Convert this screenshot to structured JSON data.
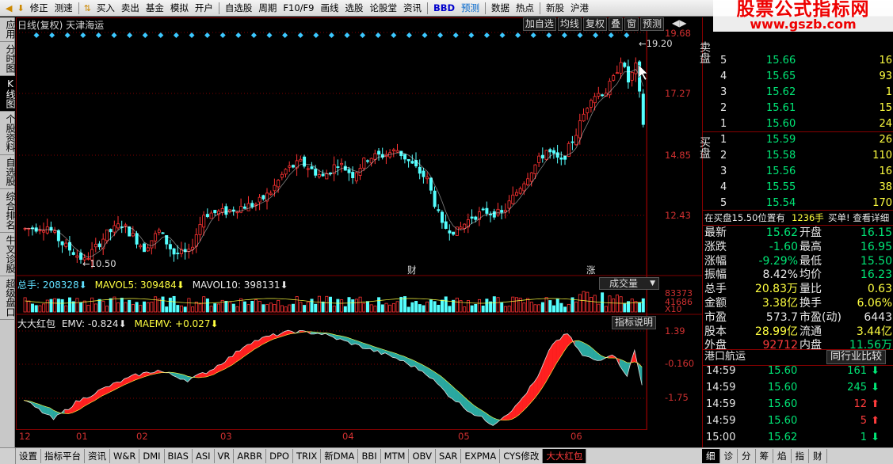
{
  "toolbar": {
    "items": [
      "修正",
      "测速",
      "买入",
      "卖出",
      "基金",
      "模拟",
      "开户",
      "自选股",
      "周期",
      "F10/F9",
      "画线",
      "选股",
      "论股堂",
      "资讯",
      "BBD",
      "预测",
      "数据",
      "热点",
      "新股",
      "沪港"
    ]
  },
  "brand": {
    "line1": "股票公式指标网",
    "line2": "www.gszb.com"
  },
  "left_tabs": [
    "应用",
    "分时图",
    "K线图",
    "个股资料",
    "自选股",
    "综合排名",
    "牛叉诊股",
    "超级盘口"
  ],
  "left_tab_active": 2,
  "chart": {
    "title": "日线(复权)  天津海运",
    "buttons": [
      "加自选",
      "均线",
      "复权",
      "叠",
      "窗",
      "预测"
    ],
    "nav_icons": [
      "arrow-left-icon",
      "arrow-right-icon"
    ],
    "price_labels": [
      "19.68",
      "17.27",
      "14.85",
      "12.43"
    ],
    "high_label": "19.20",
    "low_label": "10.50",
    "markers": [
      "财",
      "涨"
    ],
    "volume_header": {
      "total": "总手: 208328",
      "ma5": "MAVOL5: 309484",
      "ma10": "MAVOL10: 398131"
    },
    "volume_dropdown": "成交量",
    "volume_labels": [
      "83373",
      "41686",
      "X10"
    ],
    "emv_header": {
      "name": "大大红包",
      "emv": "EMV: -0.824",
      "maemv": "MAEMV: +0.027"
    },
    "emv_button": "指标说明",
    "emv_labels": [
      "1.39",
      "-0.160",
      "-1.75"
    ],
    "months": [
      "12",
      "01",
      "02",
      "03",
      "04",
      "05",
      "06"
    ],
    "colors": {
      "up": "#ff3232",
      "down": "#54ffff",
      "ma": "#ffffff",
      "grid": "#800000",
      "axis": "#d03030"
    }
  },
  "chart_data": {
    "type": "candlestick",
    "price_ylim": [
      10.0,
      20.5
    ],
    "emv_ylim": [
      -2.6,
      1.8
    ],
    "high": 19.2,
    "low": 10.5
  },
  "sell_book": {
    "label": "卖盘",
    "rows": [
      {
        "level": "5",
        "price": "15.66",
        "volume": "16"
      },
      {
        "level": "4",
        "price": "15.65",
        "volume": "93"
      },
      {
        "level": "3",
        "price": "15.62",
        "volume": "1"
      },
      {
        "level": "2",
        "price": "15.61",
        "volume": "15"
      },
      {
        "level": "1",
        "price": "15.60",
        "volume": "24"
      }
    ]
  },
  "buy_book": {
    "label": "买盘",
    "rows": [
      {
        "level": "1",
        "price": "15.59",
        "volume": "26"
      },
      {
        "level": "2",
        "price": "15.58",
        "volume": "110"
      },
      {
        "level": "3",
        "price": "15.56",
        "volume": "16"
      },
      {
        "level": "4",
        "price": "15.55",
        "volume": "38"
      },
      {
        "level": "5",
        "price": "15.54",
        "volume": "170"
      }
    ]
  },
  "notice": {
    "text": "在买盘15.50位置有",
    "qty": "1236手",
    "link": "买单! 查看详细"
  },
  "quote": [
    {
      "k1": "最新",
      "v1": "15.62",
      "c1": "grn",
      "k2": "开盘",
      "v2": "16.15",
      "c2": "grn"
    },
    {
      "k1": "涨跌",
      "v1": "-1.60",
      "c1": "grn",
      "k2": "最高",
      "v2": "16.95",
      "c2": "grn"
    },
    {
      "k1": "涨幅",
      "v1": "-9.29%",
      "c1": "grn",
      "k2": "最低",
      "v2": "15.50",
      "c2": "grn"
    },
    {
      "k1": "振幅",
      "v1": "8.42%",
      "c1": "wht",
      "k2": "均价",
      "v2": "16.23",
      "c2": "grn"
    },
    {
      "k1": "总手",
      "v1": "20.83万",
      "c1": "yel",
      "k2": "量比",
      "v2": "0.63",
      "c2": "yel"
    },
    {
      "k1": "金额",
      "v1": "3.38亿",
      "c1": "yel",
      "k2": "换手",
      "v2": "6.06%",
      "c2": "yel"
    },
    {
      "k1": "市盈",
      "v1": "573.7",
      "c1": "wht",
      "k2": "市盈(动)",
      "v2": "6443",
      "c2": "wht"
    },
    {
      "k1": "股本",
      "v1": "28.99亿",
      "c1": "yel",
      "k2": "流通",
      "v2": "3.44亿",
      "c2": "yel"
    },
    {
      "k1": "外盘",
      "v1": "92712",
      "c1": "red",
      "k2": "内盘",
      "v2": "11.56万",
      "c2": "grn"
    }
  ],
  "industry": {
    "name": "港口航运",
    "compare": "同行业比较"
  },
  "ticks": [
    {
      "time": "14:59",
      "price": "15.60",
      "vol": "161",
      "dir": "down"
    },
    {
      "time": "14:59",
      "price": "15.60",
      "vol": "245",
      "dir": "down"
    },
    {
      "time": "14:59",
      "price": "15.60",
      "vol": "12",
      "dir": "up"
    },
    {
      "time": "14:59",
      "price": "15.60",
      "vol": "5",
      "dir": "up"
    },
    {
      "time": "15:00",
      "price": "15.62",
      "vol": "1",
      "dir": "down"
    }
  ],
  "bottom_tabs": [
    "设置",
    "指标平台",
    "资讯",
    "W&R",
    "DMI",
    "BIAS",
    "ASI",
    "VR",
    "ARBR",
    "DPO",
    "TRIX",
    "新DMA",
    "BBI",
    "MTM",
    "OBV",
    "SAR",
    "EXPMA",
    "CYS修改",
    "大大红包"
  ],
  "bottom_active": 18,
  "right_tabs": [
    "细",
    "诊",
    "分",
    "筹",
    "焰",
    "指",
    "财"
  ],
  "right_active": 0
}
